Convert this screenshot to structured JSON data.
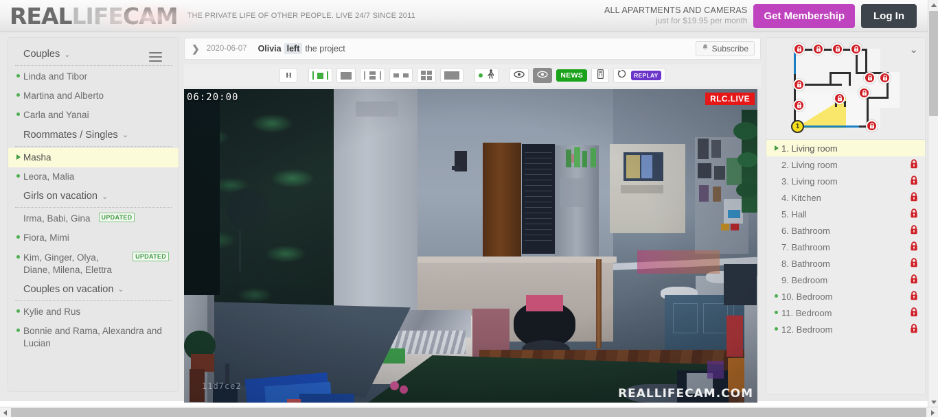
{
  "header": {
    "logo": {
      "part1": "REAL",
      "part2": "LIFE",
      "part3": "CAM"
    },
    "tagline": "THE PRIVATE LIFE OF OTHER PEOPLE. LIVE 24/7 SINCE 2011",
    "promo_line1": "ALL APARTMENTS AND CAMERAS",
    "promo_line2": "just for $19.95 per month",
    "membership_label": "Get Membership",
    "login_label": "Log In",
    "accent_purple": "#bf43bf",
    "accent_dark": "#3d444b"
  },
  "sidebar": {
    "groups": [
      {
        "title": "Couples",
        "caret": "⌄",
        "items": [
          {
            "label": "Linda and Tibor",
            "online": true,
            "updated": false
          },
          {
            "label": "Martina and Alberto",
            "online": true,
            "updated": false
          },
          {
            "label": "Carla and Yanai",
            "online": true,
            "updated": false
          }
        ]
      },
      {
        "title": "Roommates / Singles",
        "caret": "⌄",
        "items": [
          {
            "label": "Masha",
            "online": true,
            "updated": false,
            "active": true
          },
          {
            "label": "Leora, Malia",
            "online": true,
            "updated": false
          }
        ]
      },
      {
        "title": "Girls on vacation",
        "caret": "⌄",
        "items": [
          {
            "label": "Irma, Babi, Gina",
            "online": false,
            "updated": true
          },
          {
            "label": "Fiora, Mimi",
            "online": true,
            "updated": false
          },
          {
            "label": "Kim, Ginger, Olya, Diane, Milena, Elettra",
            "online": true,
            "updated": true
          }
        ]
      },
      {
        "title": "Couples on vacation",
        "caret": "⌄",
        "items": [
          {
            "label": "Kylie and Rus",
            "online": true,
            "updated": false
          },
          {
            "label": "Bonnie and Rama, Alexandra and Lucian",
            "online": true,
            "updated": false
          }
        ]
      }
    ],
    "updated_badge": "UPDATED"
  },
  "notice": {
    "chevron": "❯",
    "date": "2020-06-07",
    "name": "Olivia",
    "verb": "left",
    "rest": "the project",
    "subscribe_label": "Subscribe",
    "bell_icon": "🔔"
  },
  "toolbar": {
    "buttons": [
      {
        "name": "hd-quality-button",
        "label": "H"
      },
      {
        "name": "layout-single-highlight-button",
        "label": ""
      },
      {
        "name": "layout-single-button",
        "label": ""
      },
      {
        "name": "layout-one-plus-two-button",
        "label": ""
      },
      {
        "name": "layout-two-button",
        "label": ""
      },
      {
        "name": "layout-four-button",
        "label": ""
      },
      {
        "name": "layout-full-button",
        "label": ""
      },
      {
        "name": "motion-detect-button",
        "label": ""
      },
      {
        "name": "eye-visible-button",
        "label": ""
      },
      {
        "name": "eye-hidden-button",
        "label": ""
      },
      {
        "name": "news-button",
        "label": "NEWS"
      },
      {
        "name": "mobile-view-button",
        "label": ""
      },
      {
        "name": "replay-button",
        "label": "REPLAY"
      }
    ],
    "news_label": "NEWS",
    "replay_label": "REPLAY",
    "hd_label": "H"
  },
  "video": {
    "timestamp": "06:20:00",
    "live_badge": "RLC.LIVE",
    "stream_hash": "11d7ce2",
    "watermark": "REALLIFECAM.COM",
    "live_color": "#e51717"
  },
  "cameras": {
    "chevron": "⌄",
    "plan_label": "1",
    "locks_count": 11,
    "list": [
      {
        "label": "1. Living room",
        "locked": false,
        "online": false,
        "active": true
      },
      {
        "label": "2. Living room",
        "locked": true,
        "online": false,
        "active": false
      },
      {
        "label": "3. Living room",
        "locked": true,
        "online": false,
        "active": false
      },
      {
        "label": "4. Kitchen",
        "locked": true,
        "online": false,
        "active": false
      },
      {
        "label": "5. Hall",
        "locked": true,
        "online": false,
        "active": false
      },
      {
        "label": "6. Bathroom",
        "locked": true,
        "online": false,
        "active": false
      },
      {
        "label": "7. Bathroom",
        "locked": true,
        "online": false,
        "active": false
      },
      {
        "label": "8. Bathroom",
        "locked": true,
        "online": false,
        "active": false
      },
      {
        "label": "9. Bedroom",
        "locked": true,
        "online": false,
        "active": false
      },
      {
        "label": "10. Bedroom",
        "locked": true,
        "online": true,
        "active": false
      },
      {
        "label": "11. Bedroom",
        "locked": true,
        "online": true,
        "active": false
      },
      {
        "label": "12. Bedroom",
        "locked": true,
        "online": true,
        "active": false
      }
    ],
    "lock_color": "#cf1d24",
    "active_bg": "#fcfbd9"
  }
}
